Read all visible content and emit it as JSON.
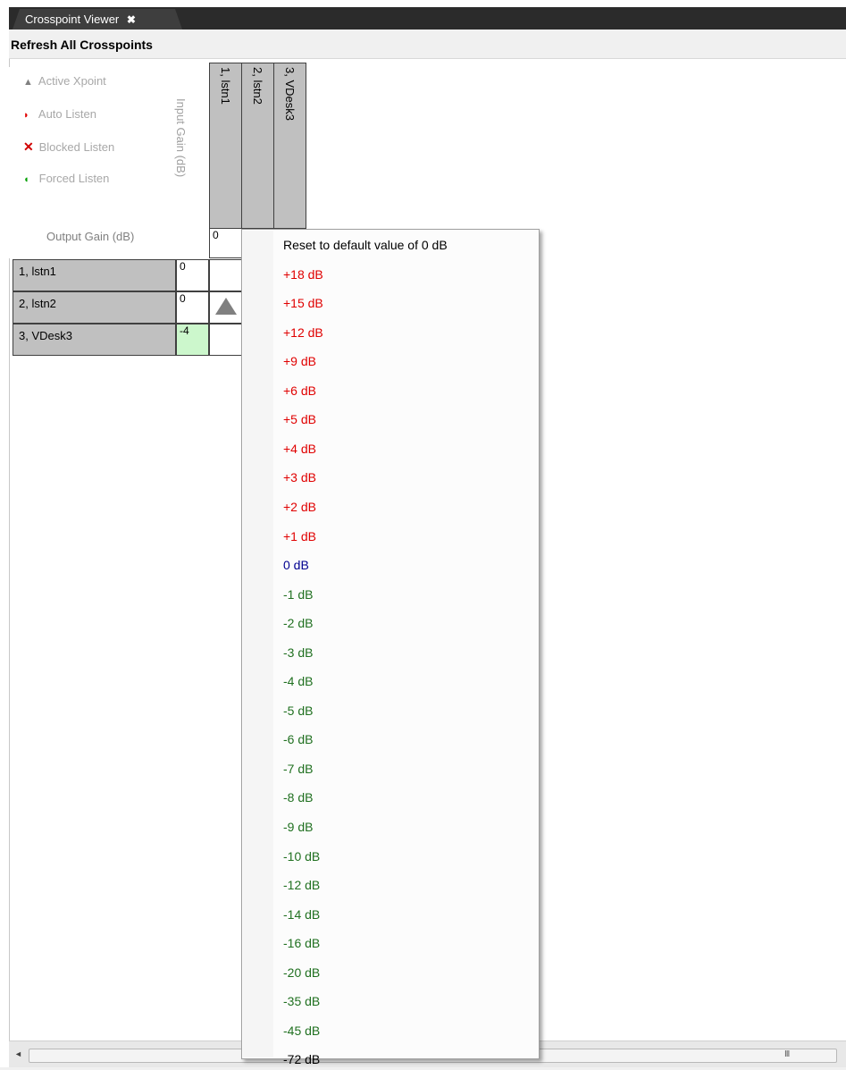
{
  "tab": {
    "title": "Crosspoint Viewer",
    "close_glyph": "✖"
  },
  "toolbar": {
    "refresh_label": "Refresh All Crosspoints"
  },
  "legend": {
    "items": [
      {
        "label": "Active Xpoint",
        "icon": "triangle-up-icon",
        "glyph": "▲",
        "color": "#808080"
      },
      {
        "label": "Auto Listen",
        "icon": "half-circle-right-icon",
        "glyph": "◗",
        "color": "#e00000"
      },
      {
        "label": "Blocked Listen",
        "icon": "x-mark-icon",
        "glyph": "✕",
        "color": "#d00000"
      },
      {
        "label": "Forced Listen",
        "icon": "half-circle-left-icon",
        "glyph": "◖",
        "color": "#00a000"
      }
    ],
    "input_gain_label": "Input Gain (dB)",
    "output_gain_label": "Output Gain (dB)"
  },
  "columns": [
    {
      "label": "1, lstn1",
      "output_gain": "0"
    },
    {
      "label": "2, lstn2",
      "output_gain": ""
    },
    {
      "label": "3, VDesk3",
      "output_gain": ""
    }
  ],
  "rows": [
    {
      "label": "1, lstn1",
      "input_gain": "0",
      "gain_highlight": false,
      "active_xpoint_col": null
    },
    {
      "label": "2, lstn2",
      "input_gain": "0",
      "gain_highlight": false,
      "active_xpoint_col": 0
    },
    {
      "label": "3, VDesk3",
      "input_gain": "-4",
      "gain_highlight": true,
      "active_xpoint_col": null
    }
  ],
  "context_menu": {
    "items": [
      {
        "label": "Reset to default value of 0 dB",
        "color": "#000000"
      },
      {
        "label": "+18 dB",
        "color": "#e00000"
      },
      {
        "label": "+15 dB",
        "color": "#e00000"
      },
      {
        "label": "+12 dB",
        "color": "#e00000"
      },
      {
        "label": "+9 dB",
        "color": "#e00000"
      },
      {
        "label": "+6 dB",
        "color": "#e00000"
      },
      {
        "label": "+5 dB",
        "color": "#e00000"
      },
      {
        "label": "+4 dB",
        "color": "#e00000"
      },
      {
        "label": "+3 dB",
        "color": "#e00000"
      },
      {
        "label": "+2 dB",
        "color": "#e00000"
      },
      {
        "label": "+1 dB",
        "color": "#e00000"
      },
      {
        "label": "0 dB",
        "color": "#000090"
      },
      {
        "label": "-1 dB",
        "color": "#207020"
      },
      {
        "label": "-2 dB",
        "color": "#207020"
      },
      {
        "label": "-3 dB",
        "color": "#207020"
      },
      {
        "label": "-4 dB",
        "color": "#207020"
      },
      {
        "label": "-5 dB",
        "color": "#207020"
      },
      {
        "label": "-6 dB",
        "color": "#207020"
      },
      {
        "label": "-7 dB",
        "color": "#207020"
      },
      {
        "label": "-8 dB",
        "color": "#207020"
      },
      {
        "label": "-9 dB",
        "color": "#207020"
      },
      {
        "label": "-10 dB",
        "color": "#207020"
      },
      {
        "label": "-12 dB",
        "color": "#207020"
      },
      {
        "label": "-14 dB",
        "color": "#207020"
      },
      {
        "label": "-16 dB",
        "color": "#207020"
      },
      {
        "label": "-20 dB",
        "color": "#207020"
      },
      {
        "label": "-35 dB",
        "color": "#207020"
      },
      {
        "label": "-45 dB",
        "color": "#207020"
      },
      {
        "label": "-72 dB",
        "color": "#000000"
      }
    ]
  },
  "scrollbar": {
    "left_arrow": "◄",
    "grip": "III"
  }
}
